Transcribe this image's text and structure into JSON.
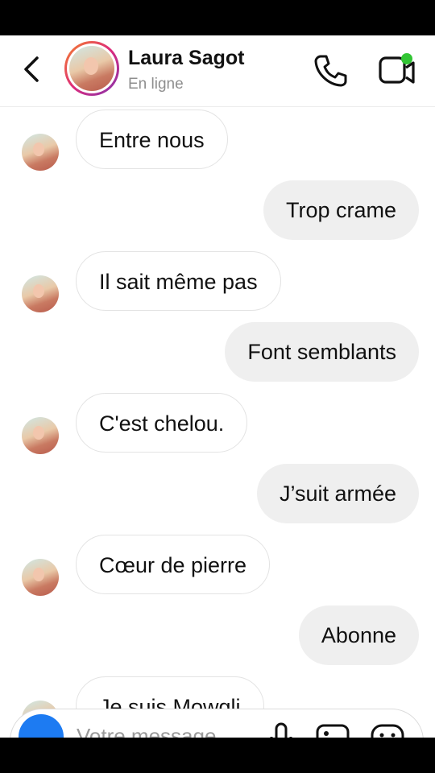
{
  "header": {
    "contact_name": "Laura Sagot",
    "status": "En ligne",
    "icons": [
      "back-chevron-icon",
      "phone-icon",
      "video-call-icon"
    ],
    "online_dot_color": "#32c534"
  },
  "messages": [
    {
      "side": "in",
      "text": "Entre nous"
    },
    {
      "side": "out",
      "text": "Trop crame"
    },
    {
      "side": "in",
      "text": "Il sait même pas"
    },
    {
      "side": "out",
      "text": "Font semblants"
    },
    {
      "side": "in",
      "text": "C'est chelou."
    },
    {
      "side": "out",
      "text": "J’suit armée"
    },
    {
      "side": "in",
      "text": "Cœur de pierre"
    },
    {
      "side": "out",
      "text": "Abonne"
    },
    {
      "side": "in",
      "text": "Je suis Mowgli"
    }
  ],
  "composer": {
    "placeholder": "Votre message…",
    "icons": [
      "camera-icon",
      "microphone-icon",
      "gallery-icon",
      "sticker-icon"
    ],
    "accent": "#1d7bf2"
  }
}
